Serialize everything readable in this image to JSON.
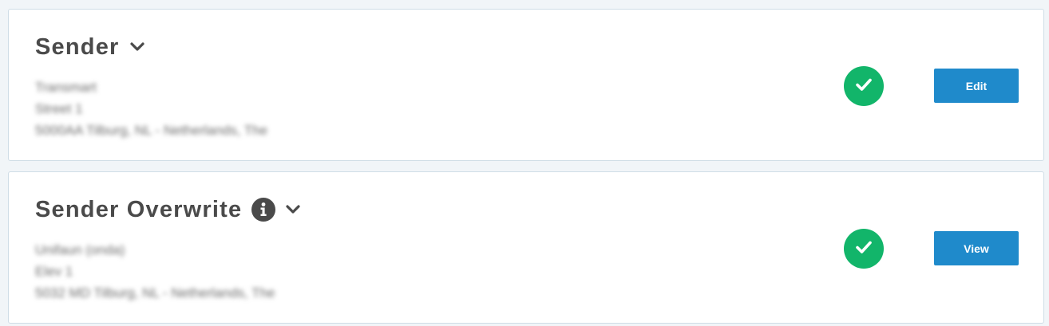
{
  "sender": {
    "title": "Sender",
    "address": {
      "line1": "Transmart",
      "line2": "Street 1",
      "line3": "5000AA Tilburg, NL - Netherlands, The"
    },
    "status": "complete",
    "action_label": "Edit"
  },
  "sender_overwrite": {
    "title": "Sender Overwrite",
    "address": {
      "line1": "Unifaun (onda)",
      "line2": "Elev 1",
      "line3": "5032 MD Tilburg, NL - Netherlands, The"
    },
    "status": "complete",
    "action_label": "View"
  },
  "colors": {
    "accent_button": "#1f8acb",
    "status_green": "#12b56a",
    "title_text": "#4a4a4a",
    "background": "#f1f5f8"
  },
  "icons": {
    "chevron": "chevron-down-icon",
    "info": "info-icon",
    "check": "check-icon"
  }
}
